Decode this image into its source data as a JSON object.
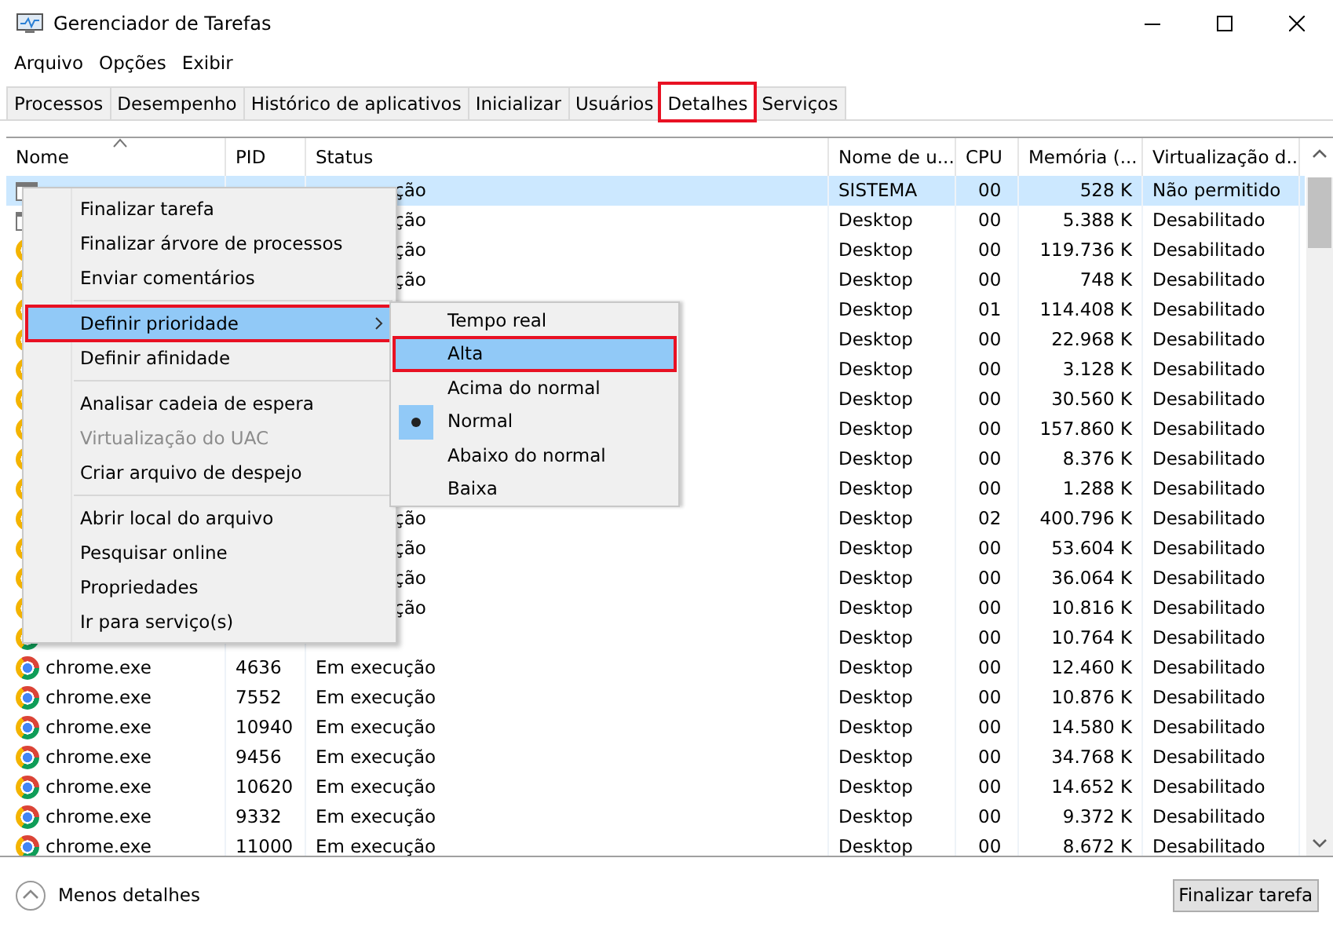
{
  "window": {
    "title": "Gerenciador de Tarefas"
  },
  "menu_bar": [
    "Arquivo",
    "Opções",
    "Exibir"
  ],
  "tabs": [
    {
      "label": "Processos",
      "selected": false,
      "outlined": false
    },
    {
      "label": "Desempenho",
      "selected": false,
      "outlined": false
    },
    {
      "label": "Histórico de aplicativos",
      "selected": false,
      "outlined": false
    },
    {
      "label": "Inicializar",
      "selected": false,
      "outlined": false
    },
    {
      "label": "Usuários",
      "selected": false,
      "outlined": false
    },
    {
      "label": "Detalhes",
      "selected": true,
      "outlined": true
    },
    {
      "label": "Serviços",
      "selected": false,
      "outlined": false
    }
  ],
  "table": {
    "columns": [
      "Nome",
      "PID",
      "Status",
      "Nome de u...",
      "CPU",
      "Memória (...",
      "Virtualização d..."
    ],
    "rows": [
      {
        "kind": "window",
        "status_tail": "ção",
        "user": "SISTEMA",
        "cpu": "00",
        "memory": "528 K",
        "virtualization": "Não permitido",
        "selected": true
      },
      {
        "kind": "window",
        "status_tail": "ção",
        "user": "Desktop",
        "cpu": "00",
        "memory": "5.388 K",
        "virtualization": "Desabilitado",
        "selected": false
      },
      {
        "kind": "chrome",
        "status_tail": "ção",
        "user": "Desktop",
        "cpu": "00",
        "memory": "119.736 K",
        "virtualization": "Desabilitado",
        "selected": false
      },
      {
        "kind": "chrome",
        "status_tail": "ção",
        "user": "Desktop",
        "cpu": "00",
        "memory": "748 K",
        "virtualization": "Desabilitado",
        "selected": false
      },
      {
        "kind": "chrome",
        "user": "Desktop",
        "cpu": "01",
        "memory": "114.408 K",
        "virtualization": "Desabilitado",
        "selected": false
      },
      {
        "kind": "chrome",
        "user": "Desktop",
        "cpu": "00",
        "memory": "22.968 K",
        "virtualization": "Desabilitado",
        "selected": false
      },
      {
        "kind": "chrome",
        "user": "Desktop",
        "cpu": "00",
        "memory": "3.128 K",
        "virtualization": "Desabilitado",
        "selected": false
      },
      {
        "kind": "chrome",
        "user": "Desktop",
        "cpu": "00",
        "memory": "30.560 K",
        "virtualization": "Desabilitado",
        "selected": false
      },
      {
        "kind": "chrome",
        "user": "Desktop",
        "cpu": "00",
        "memory": "157.860 K",
        "virtualization": "Desabilitado",
        "selected": false
      },
      {
        "kind": "chrome",
        "user": "Desktop",
        "cpu": "00",
        "memory": "8.376 K",
        "virtualization": "Desabilitado",
        "selected": false
      },
      {
        "kind": "chrome",
        "user": "Desktop",
        "cpu": "00",
        "memory": "1.288 K",
        "virtualization": "Desabilitado",
        "selected": false
      },
      {
        "kind": "chrome",
        "status_tail": "ção",
        "user": "Desktop",
        "cpu": "02",
        "memory": "400.796 K",
        "virtualization": "Desabilitado",
        "selected": false
      },
      {
        "kind": "chrome",
        "status_tail": "ção",
        "user": "Desktop",
        "cpu": "00",
        "memory": "53.604 K",
        "virtualization": "Desabilitado",
        "selected": false
      },
      {
        "kind": "chrome",
        "status_tail": "ção",
        "user": "Desktop",
        "cpu": "00",
        "memory": "36.064 K",
        "virtualization": "Desabilitado",
        "selected": false
      },
      {
        "kind": "chrome",
        "status_tail": "ção",
        "user": "Desktop",
        "cpu": "00",
        "memory": "10.816 K",
        "virtualization": "Desabilitado",
        "selected": false
      },
      {
        "kind": "chrome",
        "user": "Desktop",
        "cpu": "00",
        "memory": "10.764 K",
        "virtualization": "Desabilitado",
        "selected": false
      },
      {
        "kind": "chrome",
        "name": "chrome.exe",
        "pid": "4636",
        "status": "Em execução",
        "user": "Desktop",
        "cpu": "00",
        "memory": "12.460 K",
        "virtualization": "Desabilitado",
        "selected": false
      },
      {
        "kind": "chrome",
        "name": "chrome.exe",
        "pid": "7552",
        "status": "Em execução",
        "user": "Desktop",
        "cpu": "00",
        "memory": "10.876 K",
        "virtualization": "Desabilitado",
        "selected": false
      },
      {
        "kind": "chrome",
        "name": "chrome.exe",
        "pid": "10940",
        "status": "Em execução",
        "user": "Desktop",
        "cpu": "00",
        "memory": "14.580 K",
        "virtualization": "Desabilitado",
        "selected": false
      },
      {
        "kind": "chrome",
        "name": "chrome.exe",
        "pid": "9456",
        "status": "Em execução",
        "user": "Desktop",
        "cpu": "00",
        "memory": "34.768 K",
        "virtualization": "Desabilitado",
        "selected": false
      },
      {
        "kind": "chrome",
        "name": "chrome.exe",
        "pid": "10620",
        "status": "Em execução",
        "user": "Desktop",
        "cpu": "00",
        "memory": "14.652 K",
        "virtualization": "Desabilitado",
        "selected": false
      },
      {
        "kind": "chrome",
        "name": "chrome.exe",
        "pid": "9332",
        "status": "Em execução",
        "user": "Desktop",
        "cpu": "00",
        "memory": "9.372 K",
        "virtualization": "Desabilitado",
        "selected": false
      },
      {
        "kind": "chrome",
        "name": "chrome.exe",
        "pid": "11000",
        "status": "Em execução",
        "user": "Desktop",
        "cpu": "00",
        "memory": "8.672 K",
        "virtualization": "Desabilitado",
        "selected": false
      }
    ]
  },
  "context_menu": {
    "items": [
      {
        "kind": "item",
        "label": "Finalizar tarefa",
        "selected": false,
        "disabled": false,
        "submenu": false,
        "outlined": false
      },
      {
        "kind": "item",
        "label": "Finalizar árvore de processos",
        "selected": false,
        "disabled": false,
        "submenu": false,
        "outlined": false
      },
      {
        "kind": "item",
        "label": "Enviar comentários",
        "selected": false,
        "disabled": false,
        "submenu": false,
        "outlined": false
      },
      {
        "kind": "separator"
      },
      {
        "kind": "item",
        "label": "Definir prioridade",
        "selected": true,
        "disabled": false,
        "submenu": true,
        "outlined": true
      },
      {
        "kind": "item",
        "label": "Definir afinidade",
        "selected": false,
        "disabled": false,
        "submenu": false,
        "outlined": false
      },
      {
        "kind": "separator"
      },
      {
        "kind": "item",
        "label": "Analisar cadeia de espera",
        "selected": false,
        "disabled": false,
        "submenu": false,
        "outlined": false
      },
      {
        "kind": "item",
        "label": "Virtualização do UAC",
        "selected": false,
        "disabled": true,
        "submenu": false,
        "outlined": false
      },
      {
        "kind": "item",
        "label": "Criar arquivo de despejo",
        "selected": false,
        "disabled": false,
        "submenu": false,
        "outlined": false
      },
      {
        "kind": "separator"
      },
      {
        "kind": "item",
        "label": "Abrir local do arquivo",
        "selected": false,
        "disabled": false,
        "submenu": false,
        "outlined": false
      },
      {
        "kind": "item",
        "label": "Pesquisar online",
        "selected": false,
        "disabled": false,
        "submenu": false,
        "outlined": false
      },
      {
        "kind": "item",
        "label": "Propriedades",
        "selected": false,
        "disabled": false,
        "submenu": false,
        "outlined": false
      },
      {
        "kind": "item",
        "label": "Ir para serviço(s)",
        "selected": false,
        "disabled": false,
        "submenu": false,
        "outlined": false
      }
    ]
  },
  "priority_submenu": {
    "items": [
      {
        "label": "Tempo real",
        "selected": false,
        "checked": false,
        "outlined": false
      },
      {
        "label": "Alta",
        "selected": true,
        "checked": false,
        "outlined": true
      },
      {
        "label": "Acima do normal",
        "selected": false,
        "checked": false,
        "outlined": false
      },
      {
        "label": "Normal",
        "selected": false,
        "checked": true,
        "outlined": false
      },
      {
        "label": "Abaixo do normal",
        "selected": false,
        "checked": false,
        "outlined": false
      },
      {
        "label": "Baixa",
        "selected": false,
        "checked": false,
        "outlined": false
      }
    ]
  },
  "footer": {
    "toggle_label": "Menos detalhes",
    "button": "Finalizar tarefa"
  }
}
